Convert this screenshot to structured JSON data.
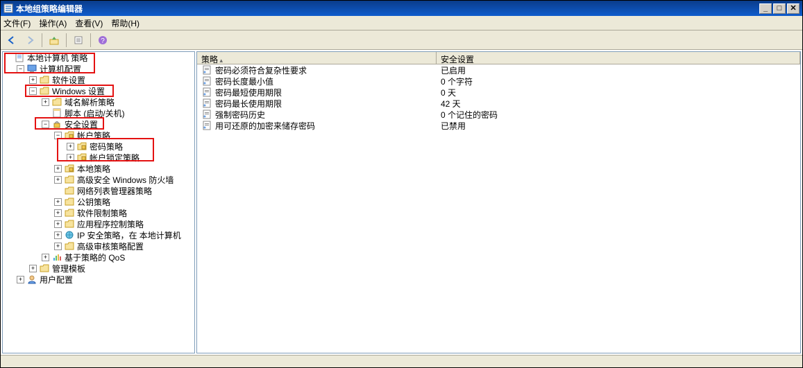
{
  "window": {
    "title": "本地组策略编辑器"
  },
  "menu": {
    "file": "文件(F)",
    "action": "操作(A)",
    "view": "查看(V)",
    "help": "帮助(H)"
  },
  "toolbar": {
    "back": "back",
    "forward": "forward",
    "up": "up",
    "refresh": "refresh",
    "export": "export",
    "help": "help"
  },
  "tree": {
    "root": "本地计算机 策略",
    "computer_config": "计算机配置",
    "software_settings": "软件设置",
    "windows_settings": "Windows 设置",
    "name_resolution": "域名解析策略",
    "scripts": "脚本 (启动/关机)",
    "security_settings": "安全设置",
    "account_policy": "帐户策略",
    "password_policy": "密码策略",
    "lockout_policy": "帐户锁定策略",
    "local_policy": "本地策略",
    "firewall": "高级安全 Windows 防火墙",
    "network_list": "网络列表管理器策略",
    "public_key": "公钥策略",
    "software_restrict": "软件限制策略",
    "app_control": "应用程序控制策略",
    "ip_security": "IP 安全策略，在 本地计算机",
    "adv_audit": "高级审核策略配置",
    "qos": "基于策略的 QoS",
    "admin_templates": "管理模板",
    "user_config": "用户配置"
  },
  "list": {
    "header": {
      "policy": "策略",
      "setting": "安全设置"
    },
    "rows": [
      {
        "policy": "密码必须符合复杂性要求",
        "setting": "已启用"
      },
      {
        "policy": "密码长度最小值",
        "setting": "0 个字符"
      },
      {
        "policy": "密码最短使用期限",
        "setting": "0 天"
      },
      {
        "policy": "密码最长使用期限",
        "setting": "42 天"
      },
      {
        "policy": "强制密码历史",
        "setting": "0 个记住的密码"
      },
      {
        "policy": "用可还原的加密来储存密码",
        "setting": "已禁用"
      }
    ]
  }
}
